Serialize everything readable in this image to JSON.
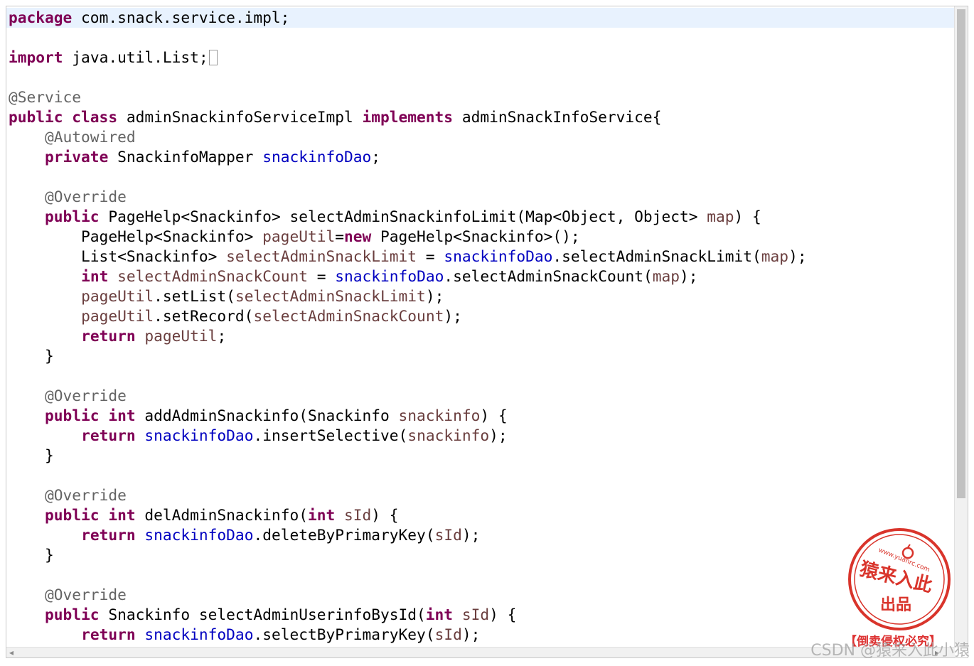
{
  "editor": {
    "lines": [
      [
        {
          "t": "package",
          "c": "kw"
        },
        {
          "t": " com.snack.service.impl;"
        }
      ],
      [],
      [
        {
          "t": "import",
          "c": "kw"
        },
        {
          "t": " java.util.List;"
        },
        {
          "fold": true
        }
      ],
      [],
      [
        {
          "t": "@Service",
          "c": "ann"
        }
      ],
      [
        {
          "t": "public class",
          "c": "kw"
        },
        {
          "t": " adminSnackinfoServiceImpl "
        },
        {
          "t": "implements",
          "c": "kw"
        },
        {
          "t": " adminSnackInfoService{"
        }
      ],
      [
        {
          "t": "    "
        },
        {
          "t": "@Autowired",
          "c": "ann"
        }
      ],
      [
        {
          "t": "    "
        },
        {
          "t": "private",
          "c": "kw"
        },
        {
          "t": " SnackinfoMapper "
        },
        {
          "t": "snackinfoDao",
          "c": "fld"
        },
        {
          "t": ";"
        }
      ],
      [],
      [
        {
          "t": "    "
        },
        {
          "t": "@Override",
          "c": "ann"
        }
      ],
      [
        {
          "t": "    "
        },
        {
          "t": "public",
          "c": "kw"
        },
        {
          "t": " PageHelp<Snackinfo> selectAdminSnackinfoLimit(Map<Object, Object> "
        },
        {
          "t": "map",
          "c": "var"
        },
        {
          "t": ") {"
        }
      ],
      [
        {
          "t": "        PageHelp<Snackinfo> "
        },
        {
          "t": "pageUtil",
          "c": "var"
        },
        {
          "t": "="
        },
        {
          "t": "new",
          "c": "kw"
        },
        {
          "t": " PageHelp<Snackinfo>();"
        }
      ],
      [
        {
          "t": "        List<Snackinfo> "
        },
        {
          "t": "selectAdminSnackLimit",
          "c": "var"
        },
        {
          "t": " = "
        },
        {
          "t": "snackinfoDao",
          "c": "fld"
        },
        {
          "t": ".selectAdminSnackLimit("
        },
        {
          "t": "map",
          "c": "var"
        },
        {
          "t": ");"
        }
      ],
      [
        {
          "t": "        "
        },
        {
          "t": "int",
          "c": "kw"
        },
        {
          "t": " "
        },
        {
          "t": "selectAdminSnackCount",
          "c": "var"
        },
        {
          "t": " = "
        },
        {
          "t": "snackinfoDao",
          "c": "fld"
        },
        {
          "t": ".selectAdminSnackCount("
        },
        {
          "t": "map",
          "c": "var"
        },
        {
          "t": ");"
        }
      ],
      [
        {
          "t": "        "
        },
        {
          "t": "pageUtil",
          "c": "var"
        },
        {
          "t": ".setList("
        },
        {
          "t": "selectAdminSnackLimit",
          "c": "var"
        },
        {
          "t": ");"
        }
      ],
      [
        {
          "t": "        "
        },
        {
          "t": "pageUtil",
          "c": "var"
        },
        {
          "t": ".setRecord("
        },
        {
          "t": "selectAdminSnackCount",
          "c": "var"
        },
        {
          "t": ");"
        }
      ],
      [
        {
          "t": "        "
        },
        {
          "t": "return",
          "c": "kw"
        },
        {
          "t": " "
        },
        {
          "t": "pageUtil",
          "c": "var"
        },
        {
          "t": ";"
        }
      ],
      [
        {
          "t": "    }"
        }
      ],
      [],
      [
        {
          "t": "    "
        },
        {
          "t": "@Override",
          "c": "ann"
        }
      ],
      [
        {
          "t": "    "
        },
        {
          "t": "public int",
          "c": "kw"
        },
        {
          "t": " addAdminSnackinfo(Snackinfo "
        },
        {
          "t": "snackinfo",
          "c": "var"
        },
        {
          "t": ") {"
        }
      ],
      [
        {
          "t": "        "
        },
        {
          "t": "return",
          "c": "kw"
        },
        {
          "t": " "
        },
        {
          "t": "snackinfoDao",
          "c": "fld"
        },
        {
          "t": ".insertSelective("
        },
        {
          "t": "snackinfo",
          "c": "var"
        },
        {
          "t": ");"
        }
      ],
      [
        {
          "t": "    }"
        }
      ],
      [],
      [
        {
          "t": "    "
        },
        {
          "t": "@Override",
          "c": "ann"
        }
      ],
      [
        {
          "t": "    "
        },
        {
          "t": "public int",
          "c": "kw"
        },
        {
          "t": " delAdminSnackinfo("
        },
        {
          "t": "int",
          "c": "kw"
        },
        {
          "t": " "
        },
        {
          "t": "sId",
          "c": "var"
        },
        {
          "t": ") {"
        }
      ],
      [
        {
          "t": "        "
        },
        {
          "t": "return",
          "c": "kw"
        },
        {
          "t": " "
        },
        {
          "t": "snackinfoDao",
          "c": "fld"
        },
        {
          "t": ".deleteByPrimaryKey("
        },
        {
          "t": "sId",
          "c": "var"
        },
        {
          "t": ");"
        }
      ],
      [
        {
          "t": "    }"
        }
      ],
      [],
      [
        {
          "t": "    "
        },
        {
          "t": "@Override",
          "c": "ann"
        }
      ],
      [
        {
          "t": "    "
        },
        {
          "t": "public",
          "c": "kw"
        },
        {
          "t": " Snackinfo selectAdminUserinfoBysId("
        },
        {
          "t": "int",
          "c": "kw"
        },
        {
          "t": " "
        },
        {
          "t": "sId",
          "c": "var"
        },
        {
          "t": ") {"
        }
      ],
      [
        {
          "t": "        "
        },
        {
          "t": "return",
          "c": "kw"
        },
        {
          "t": " "
        },
        {
          "t": "snackinfoDao",
          "c": "fld"
        },
        {
          "t": ".selectByPrimaryKey("
        },
        {
          "t": "sId",
          "c": "var"
        },
        {
          "t": ");"
        }
      ]
    ]
  },
  "watermark": {
    "stamp_url": "www.yuanrc.com",
    "stamp_main": "猿来入此",
    "stamp_sub": "出品",
    "stamp_note": "【倒卖侵权必究】",
    "credit": "CSDN @猿来入此小猿"
  },
  "colors": {
    "keyword": "#7f0055",
    "annotation": "#646464",
    "field": "#0000c0",
    "local_variable": "#6a3e3e",
    "current_line": "#e8f2fe",
    "stamp": "#d9342b"
  },
  "icons": [
    "fold-marker-icon",
    "scroll-left-icon",
    "scroll-right-icon"
  ]
}
